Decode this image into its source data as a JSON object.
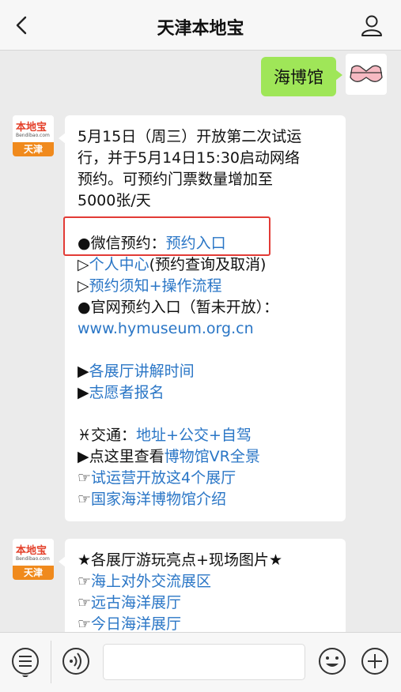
{
  "header": {
    "title": "天津本地宝"
  },
  "messages": {
    "user_query": "海博馆",
    "bot_logo": {
      "name": "本地宝",
      "site": "Bendibao.com",
      "city": "天津"
    },
    "msg1": {
      "l1": "5月15日（周三）开放第二次试运",
      "l2": "行，并于5月14日15:30启动网络",
      "l3": "预约。可预约门票数量增加至",
      "l4": "5000张/天",
      "wechat_prefix": "●微信预约：",
      "wechat_link": "预约入口",
      "personal_prefix": "▷",
      "personal_link": "个人中心",
      "personal_suffix": "(预约查询及取消)",
      "notice_prefix": "▷",
      "notice_link": "预约须知+操作流程",
      "official": "●官网预约入口（暂未开放）：",
      "official_url": "www.hymuseum.org.cn",
      "guide_prefix": "▶",
      "guide_link": "各展厅讲解时间",
      "volunteer_prefix": "▶",
      "volunteer_link": "志愿者报名",
      "traffic_prefix": "♓交通：",
      "traffic_link": "地址+公交+自驾",
      "vr_prefix": "▶点这里查看",
      "vr_link": "博物馆VR全景",
      "trial_prefix": "☞",
      "trial_link": "试运营开放这4个展厅",
      "intro_prefix": "☞",
      "intro_link": "国家海洋博物馆介绍"
    },
    "msg2": {
      "heading": "★各展厅游玩亮点+现场图片★",
      "item1_prefix": "☞",
      "item1_link": "海上对外交流展区",
      "item2_prefix": "☞",
      "item2_link": "远古海洋展厅",
      "item3_prefix": "☞",
      "item3_link": "今日海洋展厅"
    }
  },
  "colors": {
    "link": "#2a76c6",
    "user_bubble": "#9fe658",
    "highlight": "#e23b36",
    "logo_orange": "#f08a1d"
  }
}
